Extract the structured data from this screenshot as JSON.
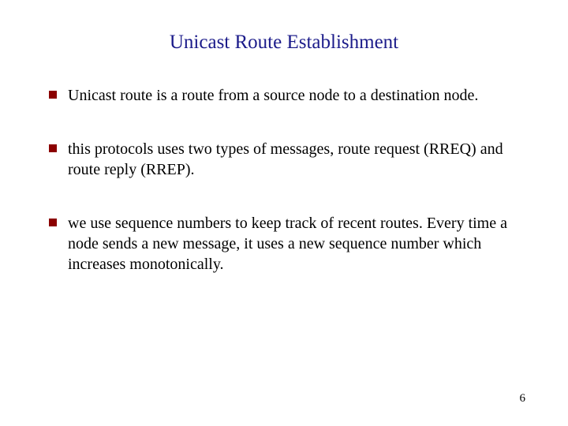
{
  "title": "Unicast Route Establishment",
  "bullets": [
    "Unicast route is a route from a source node to a destination node.",
    "this protocols uses two types of messages, route request (RREQ) and route reply (RREP).",
    "we use sequence numbers to keep track of recent routes. Every time a node sends a new message, it uses a new sequence number which increases monotonically."
  ],
  "page_number": "6"
}
